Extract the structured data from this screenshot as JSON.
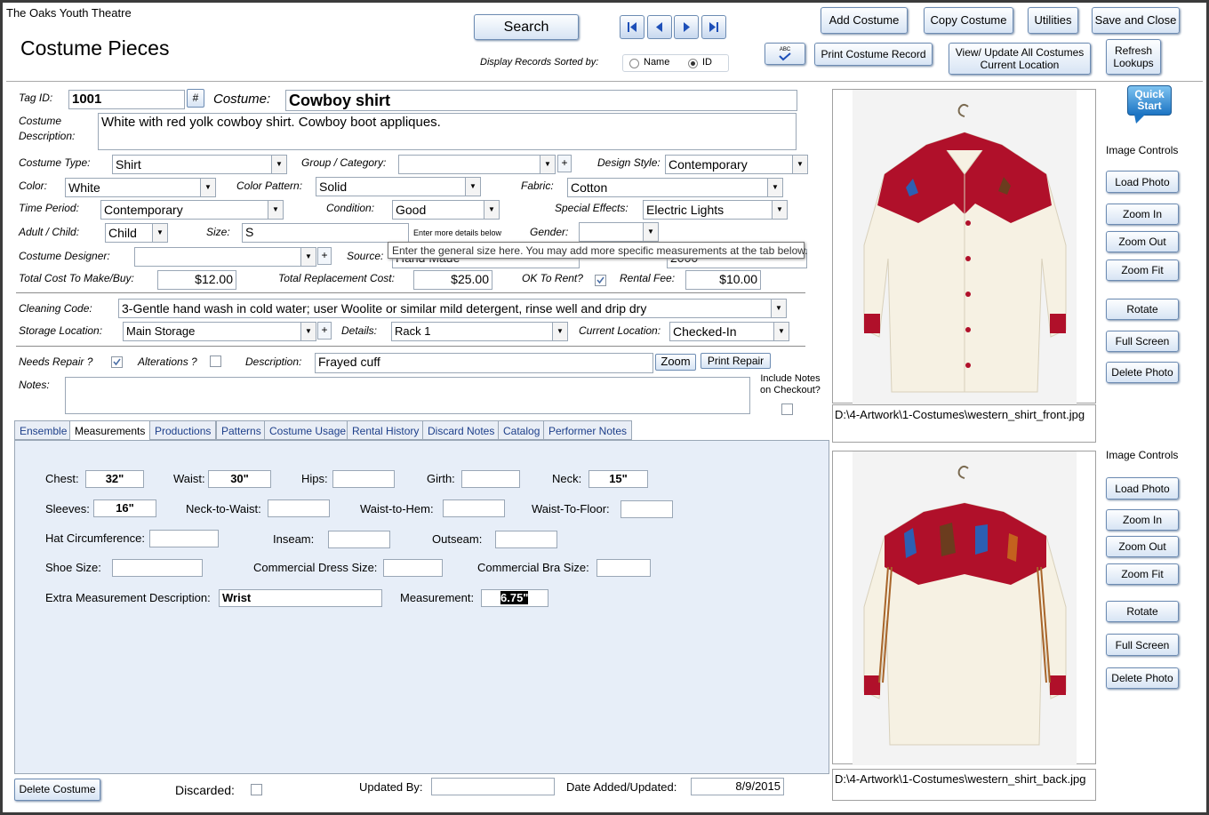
{
  "app_title": "The Oaks Youth Theatre",
  "form_title": "Costume Pieces",
  "toolbar": {
    "search": "Search",
    "add_costume": "Add Costume",
    "copy_costume": "Copy Costume",
    "utilities": "Utilities",
    "save_close": "Save and Close",
    "spell_label": "ABC",
    "print_record": "Print Costume Record",
    "view_update_1": "View/ Update All Costumes",
    "view_update_2": "Current Location",
    "refresh_1": "Refresh",
    "refresh_2": "Lookups"
  },
  "sort": {
    "label": "Display Records Sorted by:",
    "name": "Name",
    "id": "ID",
    "selected": "ID"
  },
  "quick_start_1": "Quick",
  "quick_start_2": "Start",
  "fields": {
    "tag_id_label": "Tag ID:",
    "tag_id": "1001",
    "hash": "#",
    "costume_label": "Costume:",
    "costume": "Cowboy shirt",
    "description_label_1": "Costume",
    "description_label_2": "Description:",
    "description": "White with red yolk cowboy shirt.  Cowboy boot appliques.",
    "type_label": "Costume Type:",
    "type": "Shirt",
    "group_label": "Group / Category:",
    "group": "",
    "design_label": "Design Style:",
    "design": "Contemporary",
    "color_label": "Color:",
    "color": "White",
    "pattern_label": "Color Pattern:",
    "pattern": "Solid",
    "fabric_label": "Fabric:",
    "fabric": "Cotton",
    "period_label": "Time Period:",
    "period": "Contemporary",
    "condition_label": "Condition:",
    "condition": "Good",
    "effects_label": "Special Effects:",
    "effects": "Electric Lights",
    "adult_label": "Adult / Child:",
    "adult": "Child",
    "size_label": "Size:",
    "size": "S",
    "size_hint": "Enter more details below",
    "gender_label": "Gender:",
    "gender": "",
    "designer_label": "Costume Designer:",
    "designer": "",
    "source_label": "Source:",
    "source": "Hand Made",
    "year": "2000",
    "tooltip": "Enter the general size here.  You may add more specific measurements at the tab below.",
    "cost_label": "Total Cost To Make/Buy:",
    "cost": "$12.00",
    "replacement_label": "Total Replacement Cost:",
    "replacement": "$25.00",
    "ok_rent_label": "OK To Rent?",
    "rental_label": "Rental Fee:",
    "rental": "$10.00",
    "cleaning_label": "Cleaning Code:",
    "cleaning": "3-Gentle hand wash in cold water; user Woolite or similar mild detergent, rinse well and drip dry",
    "storage_label": "Storage Location:",
    "storage": "Main Storage",
    "details_label": "Details:",
    "details": "Rack 1",
    "current_label": "Current Location:",
    "current": "Checked-In",
    "needs_repair_label": "Needs Repair ?",
    "alterations_label": "Alterations ?",
    "repair_desc_label": "Description:",
    "repair_desc": "Frayed cuff",
    "zoom": "Zoom",
    "print_repair": "Print Repair",
    "notes_label": "Notes:",
    "include_notes_1": "Include Notes",
    "include_notes_2": "on Checkout?"
  },
  "checks": {
    "ok_rent": true,
    "needs_repair": true,
    "alterations": false,
    "include_notes": false,
    "discarded": false
  },
  "tabs": [
    "Ensemble",
    "Measurements",
    "Productions",
    "Patterns",
    "Costume Usage",
    "Rental History",
    "Discard Notes",
    "Catalog",
    "Performer Notes"
  ],
  "active_tab": "Measurements",
  "measurements": {
    "chest_label": "Chest:",
    "chest": "32\"",
    "waist_label": "Waist:",
    "waist": "30\"",
    "hips_label": "Hips:",
    "hips": "",
    "girth_label": "Girth:",
    "girth": "",
    "neck_label": "Neck:",
    "neck": "15\"",
    "sleeves_label": "Sleeves:",
    "sleeves": "16\"",
    "neck_waist_label": "Neck-to-Waist:",
    "neck_waist": "",
    "waist_hem_label": "Waist-to-Hem:",
    "waist_hem": "",
    "waist_floor_label": "Waist-To-Floor:",
    "waist_floor": "",
    "hat_label": "Hat Circumference:",
    "hat": "",
    "inseam_label": "Inseam:",
    "inseam": "",
    "outseam_label": "Outseam:",
    "outseam": "",
    "shoe_label": "Shoe Size:",
    "shoe": "",
    "dress_label": "Commercial Dress Size:",
    "dress": "",
    "bra_label": "Commercial Bra Size:",
    "bra": "",
    "extra_label": "Extra Measurement Description:",
    "extra": "Wrist",
    "measurement_label": "Measurement:",
    "measurement": "6.75\""
  },
  "footer": {
    "delete": "Delete Costume",
    "discarded_label": "Discarded:",
    "updated_by_label": "Updated By:",
    "updated_by": "",
    "date_label": "Date Added/Updated:",
    "date": "8/9/2015"
  },
  "images": {
    "controls_label": "Image Controls",
    "load": "Load Photo",
    "zoom_in": "Zoom In",
    "zoom_out": "Zoom Out",
    "zoom_fit": "Zoom Fit",
    "rotate": "Rotate",
    "full_screen": "Full Screen",
    "delete": "Delete Photo",
    "front_path": "D:\\4-Artwork\\1-Costumes\\western_shirt_front.jpg",
    "back_path": "D:\\4-Artwork\\1-Costumes\\western_shirt_back.jpg"
  },
  "colors": {
    "accent": "#1d3f8a",
    "panel": "#e7eef8",
    "shirt_yoke": "#b0102a",
    "shirt_body": "#f6f1e3"
  }
}
